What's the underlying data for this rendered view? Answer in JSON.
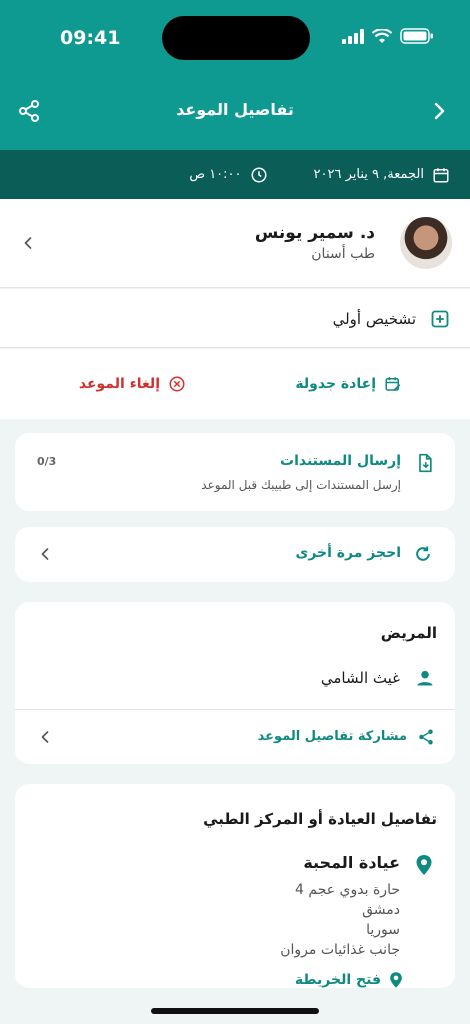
{
  "status": {
    "time": "09:41"
  },
  "header": {
    "title": "تفاصيل الموعد"
  },
  "appointment": {
    "date": "الجمعة, ٩ يناير ٢٠٢٦",
    "time": "١٠:٠٠ ص"
  },
  "doctor": {
    "name": "د. سمير يونس",
    "specialty": "طب أسنان"
  },
  "diagnosis": {
    "label": "تشخيص أولي"
  },
  "actions": {
    "reschedule": "إعادة جدولة",
    "cancel": "إلغاء الموعد"
  },
  "documents": {
    "title": "إرسال المستندات",
    "subtitle": "إرسل المستندات إلى طبيبك قبل الموعد",
    "count": "0/3"
  },
  "book_again": {
    "label": "احجز مرة أخرى"
  },
  "patient": {
    "title": "المريض",
    "name": "غيث الشامي",
    "share_label": "مشاركة تفاصيل الموعد"
  },
  "clinic": {
    "title": "تفاصيل العيادة أو المركز الطبي",
    "name": "عيادة المحبة",
    "address": [
      "حارة بدوي عجم 4",
      "دمشق",
      "سوريا",
      "جانب غذائيات مروان"
    ],
    "map_label": "فتح الخريطة"
  },
  "colors": {
    "primary": "#0f9a91",
    "primary_dark": "#0b5e58",
    "accent_text": "#0f8a82",
    "danger": "#d32f2f",
    "background": "#eef5f4"
  }
}
